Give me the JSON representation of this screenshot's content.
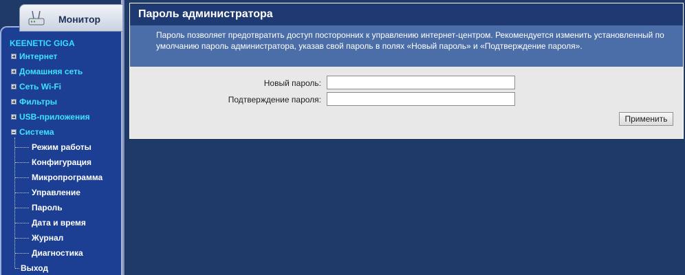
{
  "sidebar": {
    "monitor_tab": {
      "label": "Монитор",
      "icon": "router-icon"
    },
    "brand": "KEENETIC GIGA",
    "items": [
      {
        "label": "Интернет",
        "expanded": false
      },
      {
        "label": "Домашняя сеть",
        "expanded": false
      },
      {
        "label": "Сеть Wi-Fi",
        "expanded": false
      },
      {
        "label": "Фильтры",
        "expanded": false
      },
      {
        "label": "USB-приложения",
        "expanded": false
      },
      {
        "label": "Система",
        "expanded": true
      }
    ],
    "system_subitems": [
      "Режим работы",
      "Конфигурация",
      "Микропрограмма",
      "Управление",
      "Пароль",
      "Дата и время",
      "Журнал",
      "Диагностика"
    ],
    "exit": "Выход"
  },
  "panel": {
    "title": "Пароль администратора",
    "description": "Пароль позволяет предотвратить доступ посторонних к управлению интернет-центром. Рекомендуется изменить установленный по умолчанию пароль администратора, указав свой пароль в полях «Новый пароль» и «Подтверждение пароля».",
    "new_password": {
      "label": "Новый пароль:",
      "value": ""
    },
    "confirm_password": {
      "label": "Подтверждение пароля:",
      "value": ""
    },
    "apply_button": "Применить"
  },
  "colors": {
    "background": "#1f3a66",
    "nav_bg": "#1c3f94",
    "nav_link": "#3fe3ff",
    "header_bg": "#1f3a72",
    "desc_bg": "#4b6da8",
    "panel_bg": "#e8e8e8"
  }
}
